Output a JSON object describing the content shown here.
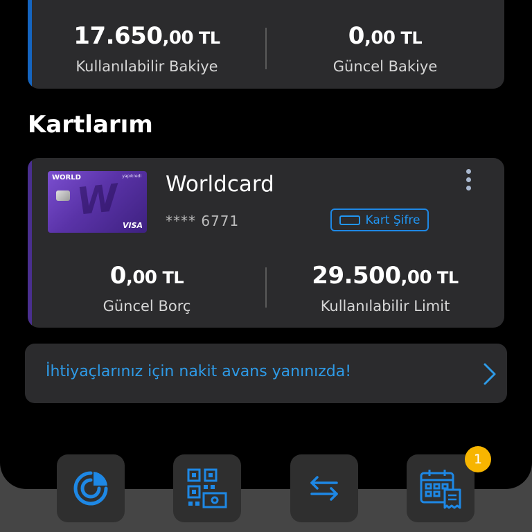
{
  "balance": {
    "available": {
      "whole": "17.650",
      "decimal": ",00",
      "currency": "TL",
      "label": "Kullanılabilir Bakiye"
    },
    "current": {
      "whole": "0",
      "decimal": ",00",
      "currency": "TL",
      "label": "Güncel Bakiye"
    }
  },
  "cards_section": {
    "title": "Kartlarım"
  },
  "card": {
    "name": "Worldcard",
    "masked_number": "**** 6771",
    "image_brand": "WORLD",
    "image_network": "VISA",
    "image_bank": "yapıkredi",
    "pin_button_label": "Kart Şifre",
    "debt": {
      "whole": "0",
      "decimal": ",00",
      "currency": "TL",
      "label": "Güncel Borç"
    },
    "limit": {
      "whole": "29.500",
      "decimal": ",00",
      "currency": "TL",
      "label": "Kullanılabilir Limit"
    }
  },
  "promo": {
    "text": "İhtiyaçlarınız için nakit avans yanınızda!"
  },
  "bottom_nav": {
    "items": [
      {
        "icon": "pie-chart-icon"
      },
      {
        "icon": "qr-money-icon"
      },
      {
        "icon": "transfer-arrows-icon"
      },
      {
        "icon": "calendar-receipt-icon",
        "badge": "1"
      }
    ]
  },
  "colors": {
    "accent_blue": "#1e88e5",
    "badge_yellow": "#f7b500",
    "card_purple": "#4a2f8f"
  }
}
